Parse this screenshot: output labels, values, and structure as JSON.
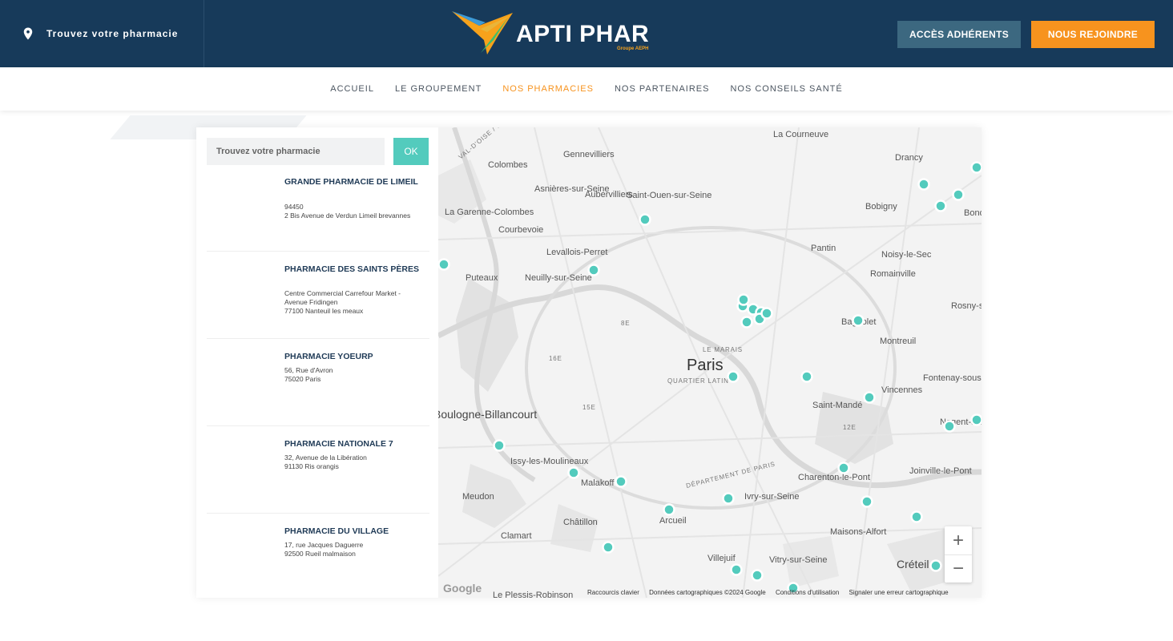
{
  "header": {
    "find_label": "Trouvez votre pharmacie",
    "brand": "APTI PHAR",
    "brand_sub": "Groupe AEPH",
    "acces_label": "ACCÈS ADHÉRENTS",
    "join_label": "NOUS REJOINDRE"
  },
  "nav": {
    "items": [
      "ACCUEIL",
      "LE GROUPEMENT",
      "NOS PHARMACIES",
      "NOS PARTENAIRES",
      "NOS CONSEILS SANTÉ"
    ],
    "active": "NOS PHARMACIES"
  },
  "search": {
    "placeholder": "Trouvez votre pharmacie",
    "button": "OK"
  },
  "results": [
    {
      "name": "GRANDE PHARMACIE DE LIMEIL",
      "address": [
        "94450",
        "2 Bis Avenue de Verdun Limeil brevannes"
      ]
    },
    {
      "name": "PHARMACIE DES SAINTS PÈRES",
      "address": [
        "Centre Commercial Carrefour Market - Avenue Fridingen",
        "77100 Nanteuil les meaux"
      ]
    },
    {
      "name": "PHARMACIE YOEURP",
      "address": [
        "56, Rue d'Avron",
        "75020 Paris"
      ]
    },
    {
      "name": "PHARMACIE NATIONALE 7",
      "address": [
        "32, Avenue de la Libération",
        "91130 Ris orangis"
      ]
    },
    {
      "name": "PHARMACIE DU VILLAGE",
      "address": [
        "17, rue Jacques Daguerre",
        "92500 Rueil malmaison"
      ]
    }
  ],
  "map": {
    "places": [
      {
        "name": "La Courneuve",
        "cls": "sm"
      },
      {
        "name": "Drancy",
        "cls": "sm"
      },
      {
        "name": "Gennevilliers",
        "cls": "sm"
      },
      {
        "name": "Colombes",
        "cls": "sm"
      },
      {
        "name": "Asnières-sur-Seine",
        "cls": "sm"
      },
      {
        "name": "Saint-Ouen-sur-Seine",
        "cls": "sm"
      },
      {
        "name": "Aubervilliers",
        "cls": "sm"
      },
      {
        "name": "Bobigny",
        "cls": "sm"
      },
      {
        "name": "Bondy",
        "cls": "sm"
      },
      {
        "name": "La Garenne-Colombes",
        "cls": "sm"
      },
      {
        "name": "Courbevoie",
        "cls": "sm"
      },
      {
        "name": "Levallois-Perret",
        "cls": "sm"
      },
      {
        "name": "Pantin",
        "cls": "sm"
      },
      {
        "name": "Noisy-le-Sec",
        "cls": "sm"
      },
      {
        "name": "Puteaux",
        "cls": "sm"
      },
      {
        "name": "Neuilly-sur-Seine",
        "cls": "sm"
      },
      {
        "name": "Romainville",
        "cls": "sm"
      },
      {
        "name": "Rosny-sous-Bois",
        "cls": "sm"
      },
      {
        "name": "Bagnolet",
        "cls": "sm"
      },
      {
        "name": "Montreuil",
        "cls": "sm"
      },
      {
        "name": "Paris",
        "cls": "big"
      },
      {
        "name": "LE MARAIS",
        "cls": "tiny"
      },
      {
        "name": "QUARTIER LATIN",
        "cls": "tiny"
      },
      {
        "name": "Fontenay-sous-Bois",
        "cls": "sm"
      },
      {
        "name": "Vincennes",
        "cls": "sm"
      },
      {
        "name": "Saint-Mandé",
        "cls": "sm"
      },
      {
        "name": "Nogent-sur-Marne",
        "cls": "sm"
      },
      {
        "name": "Boulogne-Billancourt",
        "cls": "md"
      },
      {
        "name": "Issy-les-Moulineaux",
        "cls": "sm"
      },
      {
        "name": "Malakoff",
        "cls": "sm"
      },
      {
        "name": "Joinville-le-Pont",
        "cls": "sm"
      },
      {
        "name": "Charenton-le-Pont",
        "cls": "sm"
      },
      {
        "name": "Meudon",
        "cls": "sm"
      },
      {
        "name": "Ivry-sur-Seine",
        "cls": "sm"
      },
      {
        "name": "Châtillon",
        "cls": "sm"
      },
      {
        "name": "Arcueil",
        "cls": "sm"
      },
      {
        "name": "Clamart",
        "cls": "sm"
      },
      {
        "name": "Maisons-Alfort",
        "cls": "sm"
      },
      {
        "name": "Villejuif",
        "cls": "sm"
      },
      {
        "name": "Vitry-sur-Seine",
        "cls": "sm"
      },
      {
        "name": "Créteil",
        "cls": "md"
      },
      {
        "name": "Le Plessis-Robinson",
        "cls": "sm"
      },
      {
        "name": "8E",
        "cls": "tiny"
      },
      {
        "name": "16E",
        "cls": "tiny"
      },
      {
        "name": "15E",
        "cls": "tiny"
      },
      {
        "name": "12E",
        "cls": "tiny"
      },
      {
        "name": "DÉPARTEMENT DE PARIS",
        "cls": "tiny"
      },
      {
        "name": "VAL-D'OISE / HAUTS-DE-SEINE",
        "cls": "tiny"
      }
    ],
    "zoom_in": "+",
    "zoom_out": "−",
    "google": "Google",
    "attribution": [
      "Raccourcis clavier",
      "Données cartographiques ©2024 Google",
      "Conditions d'utilisation",
      "Signaler une erreur cartographique"
    ]
  },
  "colors": {
    "navy": "#173a5a",
    "orange": "#f7931e",
    "teal": "#53cbbd",
    "acces_bg": "#3c6880"
  }
}
